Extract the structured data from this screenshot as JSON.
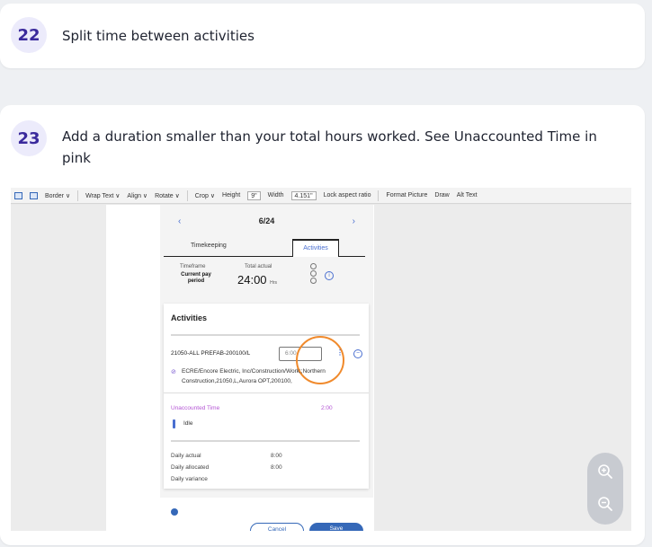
{
  "steps": [
    {
      "number": "22",
      "text": "Split time between activities"
    },
    {
      "number": "23",
      "text": "Add a duration smaller than your total hours worked. See Unaccounted Time in pink"
    }
  ],
  "screenshot": {
    "ribbon": {
      "border": "Border ∨",
      "wrap_text": "Wrap Text ∨",
      "align": "Align ∨",
      "rotate": "Rotate ∨",
      "crop": "Crop ∨",
      "height_label": "Height",
      "height_value": "9\"",
      "width_label": "Width",
      "width_value": "4.151\"",
      "lock_aspect": "Lock aspect ratio",
      "format_picture": "Format Picture",
      "draw": "Draw",
      "alt_text": "Alt Text"
    },
    "app": {
      "prev": "‹",
      "date": "6/24",
      "next": "›",
      "tab_timekeeping": "Timekeeping",
      "tab_activities": "Activities",
      "timeframe_label": "Timeframe",
      "timeframe_value": "Current pay period",
      "total_actual_label": "Total actual",
      "total_actual_value": "24:00",
      "total_actual_unit": "Hrs",
      "activities_title": "Activities",
      "job_code": "21050-ALL PREFAB-200100/L",
      "duration_value": "6:00",
      "job_description": "ECRE/Encore Electric, Inc/Construction/Work;;Northern Construction,21050,L,Aurora OPT,200100,",
      "unaccounted_label": "Unaccounted Time",
      "unaccounted_value": "2:00",
      "idle_label": "Idle",
      "daily_actual_label": "Daily actual",
      "daily_actual_value": "8:00",
      "daily_allocated_label": "Daily allocated",
      "daily_allocated_value": "8:00",
      "daily_variance_label": "Daily variance",
      "cancel_label": "Cancel",
      "save_label": "Save"
    }
  },
  "colors": {
    "accent": "#3a2a9c",
    "unaccounted": "#b455d4",
    "highlight": "#f08a2c",
    "app_blue": "#3568b8"
  },
  "icons": {
    "zoom_in": "zoom-in-icon",
    "zoom_out": "zoom-out-icon"
  }
}
